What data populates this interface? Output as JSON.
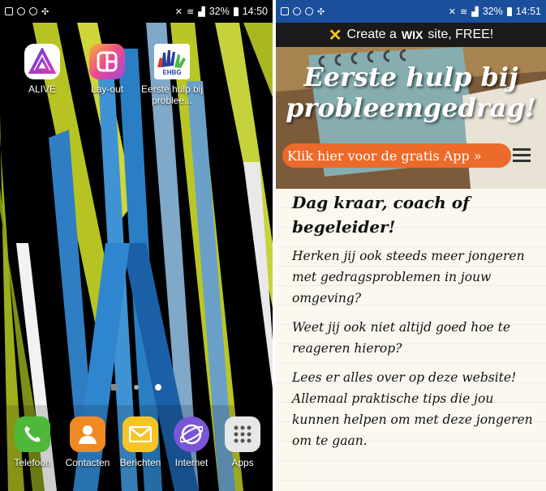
{
  "left": {
    "status": {
      "battery": "32%",
      "time": "14:50"
    },
    "apps": [
      {
        "label": "ALIVE"
      },
      {
        "label": "Lay-out"
      },
      {
        "label": "Eerste hulp bij problee..."
      }
    ],
    "dock": [
      {
        "label": "Telefoon"
      },
      {
        "label": "Contacten"
      },
      {
        "label": "Berichten"
      },
      {
        "label": "Internet"
      },
      {
        "label": "Apps"
      }
    ],
    "logo_text": "EHBG"
  },
  "right": {
    "status": {
      "battery": "32%",
      "time": "14:51"
    },
    "wix_banner": {
      "pre": "Create a",
      "brand": "WIX",
      "post": "site, FREE!"
    },
    "hero": {
      "title": "Eerste hulp bij probleemgedrag!",
      "app_link": "Klik hier voor de gratis App »"
    },
    "heading": "Dag kraar, coach of begeleider!",
    "paragraphs": [
      "Herken jij ook steeds meer jongeren met gedragsproblemen in jouw omgeving?",
      "Weet jij ook niet altijd goed hoe te reageren hierop?",
      "Lees er alles over op deze website! Allemaal praktische tips die jou kunnen helpen om met deze jongeren om te gaan."
    ]
  },
  "colors": {
    "wix_yellow": "#f7c61a",
    "app_pill": "#ec6a2a",
    "status_blue": "#1b4f9c"
  }
}
